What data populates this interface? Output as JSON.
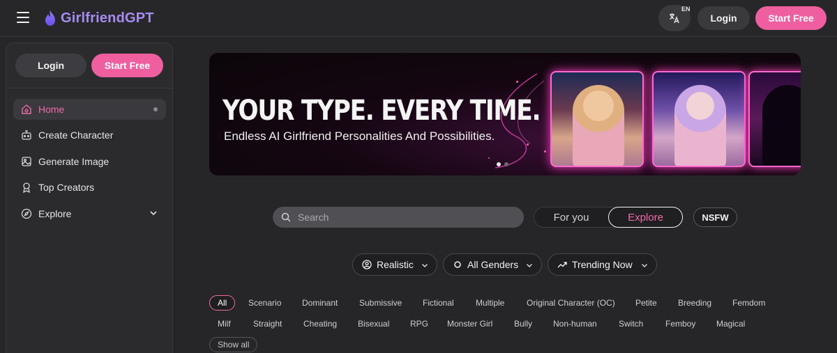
{
  "header": {
    "brand": "GirlfriendGPT",
    "lang_badge": "EN",
    "login_label": "Login",
    "start_label": "Start Free"
  },
  "sidebar": {
    "login_label": "Login",
    "start_label": "Start Free",
    "items": [
      {
        "label": "Home",
        "icon": "home-icon"
      },
      {
        "label": "Create Character",
        "icon": "robot-icon"
      },
      {
        "label": "Generate Image",
        "icon": "image-icon"
      },
      {
        "label": "Top Creators",
        "icon": "award-icon"
      },
      {
        "label": "Explore",
        "icon": "compass-icon"
      }
    ]
  },
  "banner": {
    "title": "YOUR TYPE. EVERY TIME.",
    "subtitle": "Endless AI Girlfriend Personalities And Possibilities."
  },
  "search": {
    "placeholder": "Search"
  },
  "tabs": {
    "for_you": "For you",
    "explore": "Explore"
  },
  "nsfw_label": "NSFW",
  "filters": {
    "style": "Realistic",
    "gender": "All Genders",
    "sort": "Trending Now"
  },
  "tags": {
    "row1": [
      "All",
      "Scenario",
      "Dominant",
      "Submissive",
      "Fictional",
      "Multiple",
      "Original Character (OC)",
      "Petite",
      "Breeding",
      "Femdom"
    ],
    "row2": [
      "Milf",
      "Straight",
      "Cheating",
      "Bisexual",
      "RPG",
      "Monster Girl",
      "Bully",
      "Non-human",
      "Switch",
      "Femboy",
      "Magical"
    ],
    "show_all": "Show all"
  },
  "colors": {
    "accent": "#ef5fa0",
    "brand": "#a58cf0",
    "background": "#262628"
  }
}
